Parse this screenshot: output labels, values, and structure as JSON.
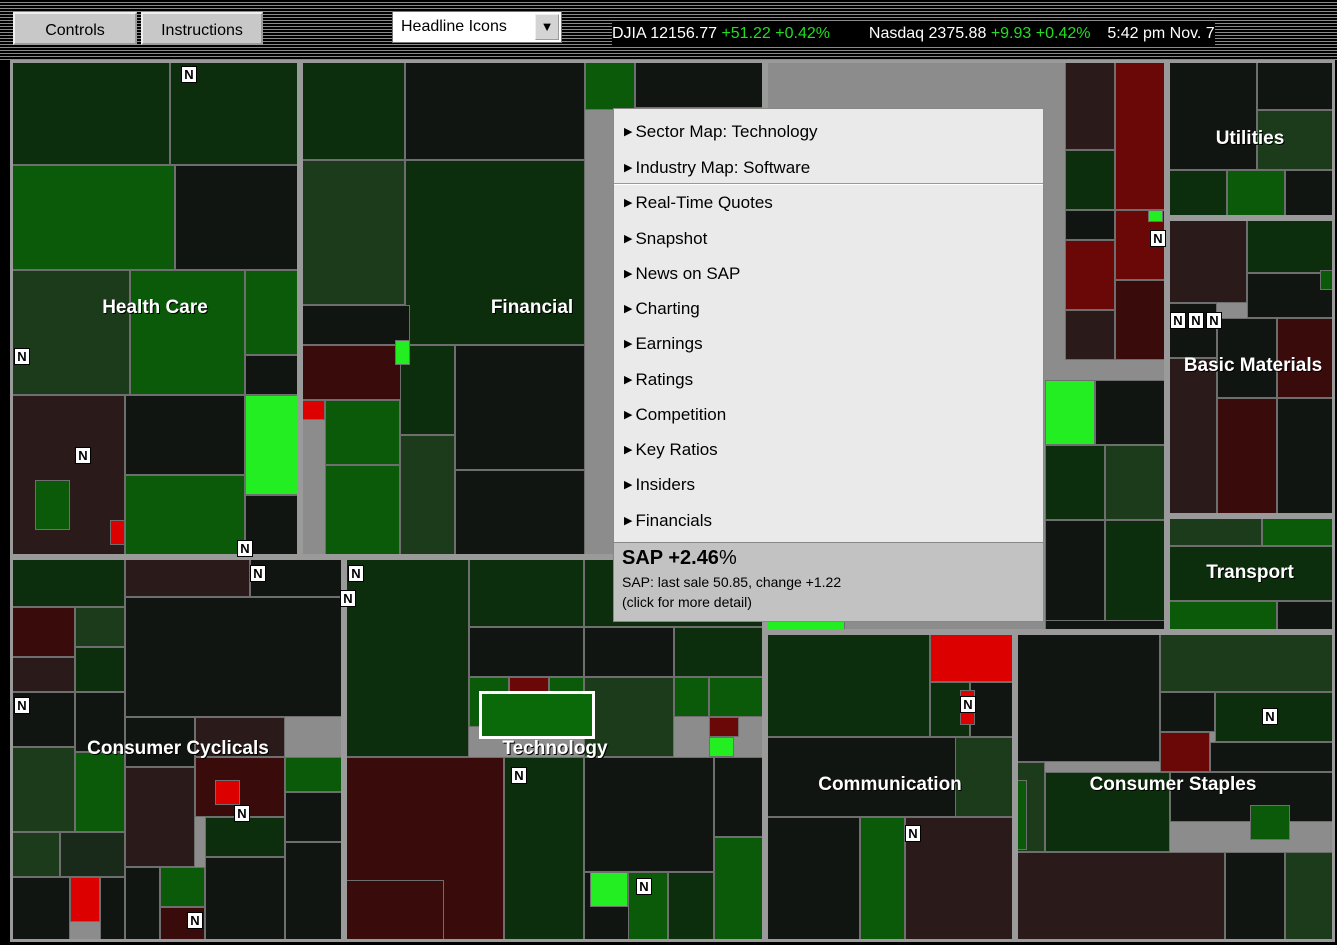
{
  "toolbar": {
    "controls_label": "Controls",
    "instructions_label": "Instructions",
    "view_select_value": "Headline Icons"
  },
  "ticker": {
    "djia_label": "DJIA",
    "djia_value": "12156.77",
    "djia_change": "+51.22",
    "djia_pct": "+0.42%",
    "nasdaq_label": "Nasdaq",
    "nasdaq_value": "2375.88",
    "nasdaq_change": "+9.93",
    "nasdaq_pct": "+0.42%",
    "time": "5:42 pm",
    "date": "Nov. 7"
  },
  "sectors": [
    {
      "label": "Health Care"
    },
    {
      "label": "Financial"
    },
    {
      "label": "Utilities"
    },
    {
      "label": "Basic Materials"
    },
    {
      "label": "Transport"
    },
    {
      "label": "Consumer Cyclicals"
    },
    {
      "label": "Technology"
    },
    {
      "label": "Communication"
    },
    {
      "label": "Consumer Staples"
    }
  ],
  "news_icon_letter": "N",
  "popup": {
    "items": [
      "Sector Map: Technology",
      "Industry Map: Software",
      "Real-Time Quotes",
      "Snapshot",
      "News on SAP",
      "Charting",
      "Earnings",
      "Ratings",
      "Competition",
      "Key Ratios",
      "Insiders",
      "Financials"
    ],
    "stock_symbol": "SAP",
    "stock_pct": "+2.46",
    "stock_pct_sign": "%",
    "detail_line": "SAP: last sale 50.85,  change +1.22",
    "hint_line": "(click for more detail)"
  },
  "colors": {
    "up_text": "#22dd22",
    "positive_tile": "#0a6a0a",
    "negative_tile": "#6a0808",
    "bright_up": "#22ee22",
    "bright_down": "#dd0000"
  }
}
